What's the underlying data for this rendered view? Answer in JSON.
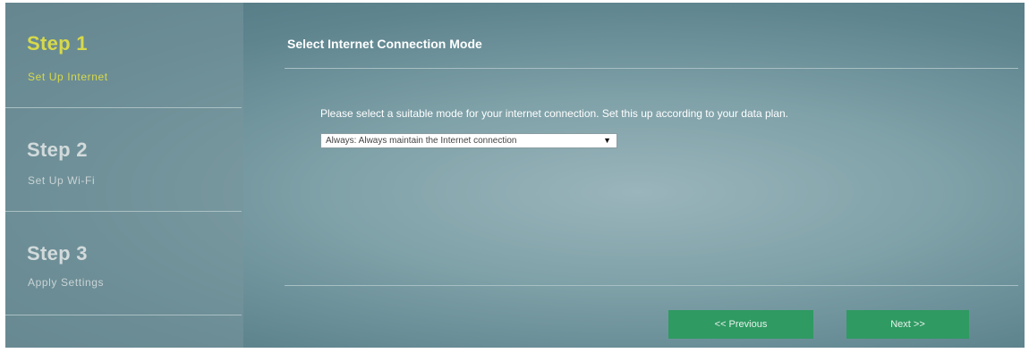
{
  "steps": [
    {
      "number": "Step 1",
      "label": "Set Up Internet"
    },
    {
      "number": "Step 2",
      "label": "Set Up Wi-Fi"
    },
    {
      "number": "Step 3",
      "label": "Apply Settings"
    }
  ],
  "main": {
    "title": "Select Internet Connection Mode",
    "description": "Please select a suitable mode for your internet connection. Set this up according to your data plan.",
    "mode_select": {
      "selected": "Always: Always maintain the Internet connection"
    }
  },
  "buttons": {
    "previous": "<< Previous",
    "next": "Next >>"
  },
  "colors": {
    "active_step": "#d7d94a",
    "button": "#2f9a62"
  }
}
